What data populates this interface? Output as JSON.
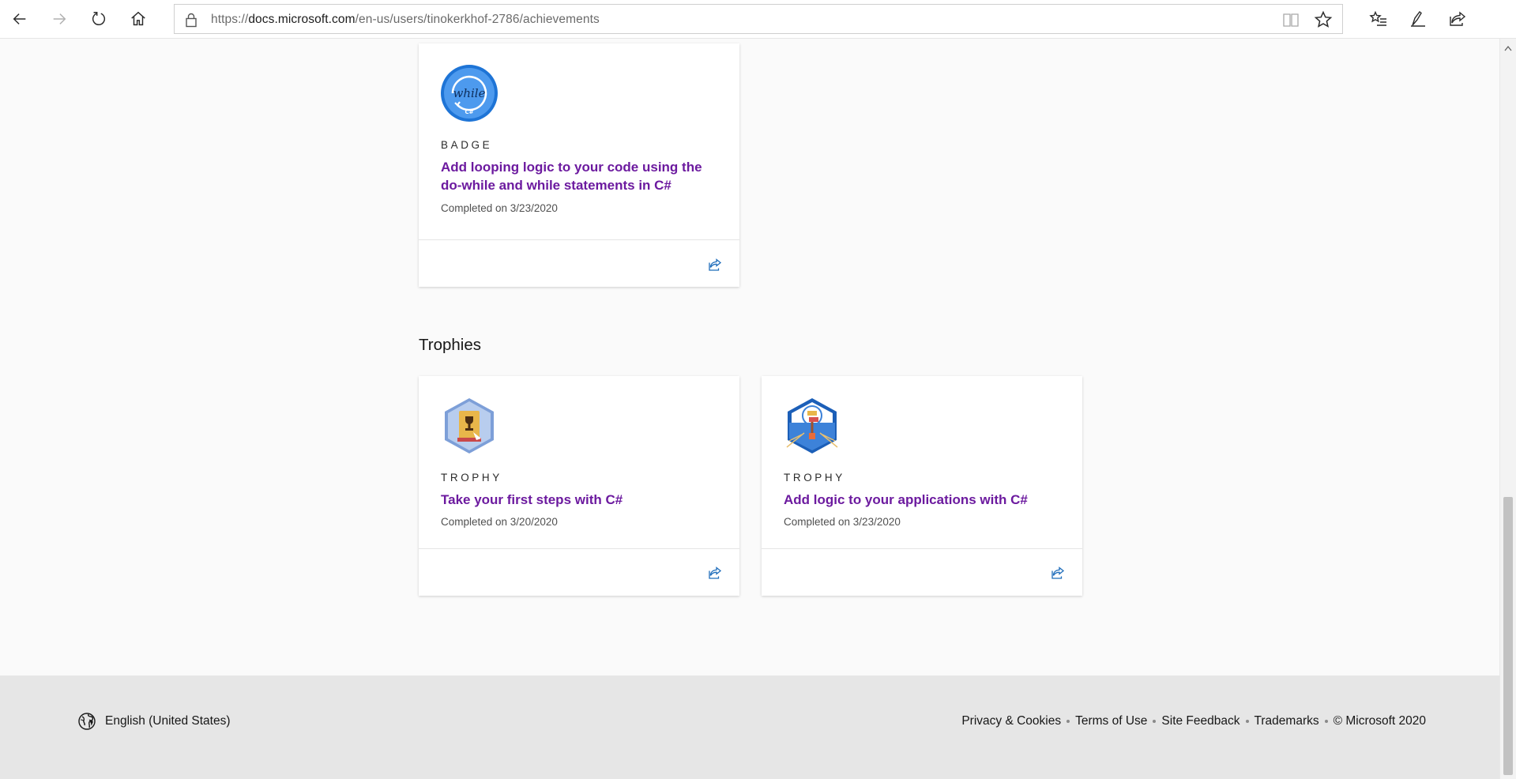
{
  "browser": {
    "url_prefix": "https://",
    "url_domain": "docs.microsoft.com",
    "url_path": "/en-us/users/tinokerkhof-2786/achievements"
  },
  "badges": [
    {
      "kind": "BADGE",
      "title": "Add looping logic to your code using the do-while and while statements in C#",
      "date": "Completed on 3/23/2020",
      "icon": "while-loop-badge-icon",
      "icon_text": "while",
      "icon_subtext": "C#"
    }
  ],
  "trophies_heading": "Trophies",
  "trophies": [
    {
      "kind": "TROPHY",
      "title": "Take your first steps with C#",
      "date": "Completed on 3/20/2020",
      "icon": "first-steps-trophy-icon"
    },
    {
      "kind": "TROPHY",
      "title": "Add logic to your applications with C#",
      "date": "Completed on 3/23/2020",
      "icon": "logic-trophy-icon"
    }
  ],
  "footer": {
    "language": "English (United States)",
    "links": [
      "Privacy & Cookies",
      "Terms of Use",
      "Site Feedback",
      "Trademarks"
    ],
    "copyright": "© Microsoft 2020"
  },
  "colors": {
    "title_purple": "#6c1a9f",
    "share_blue": "#1f6dbb",
    "badge_blue": "#1e74d6",
    "footer_bg": "#e6e6e6",
    "page_bg": "#fafafa"
  }
}
